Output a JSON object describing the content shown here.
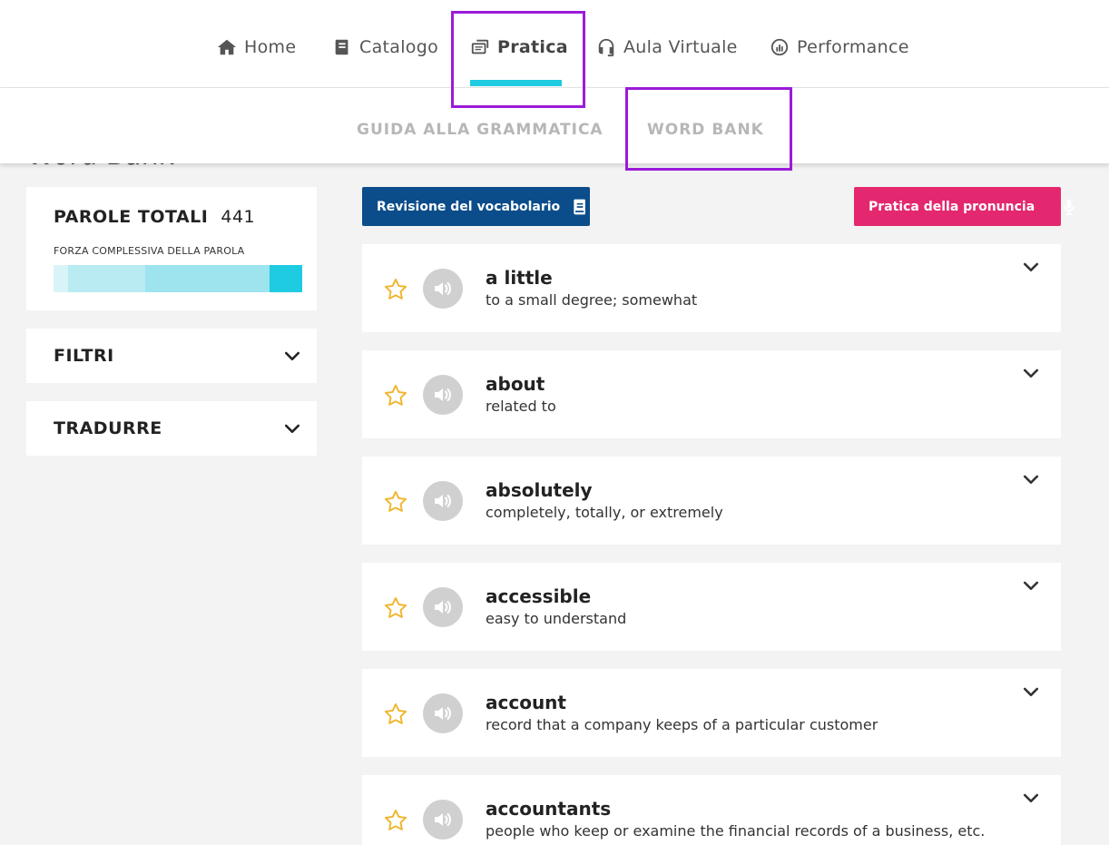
{
  "nav": {
    "items": [
      {
        "label": "Home",
        "icon": "home-icon"
      },
      {
        "label": "Catalogo",
        "icon": "book-icon"
      },
      {
        "label": "Pratica",
        "icon": "practice-icon",
        "active": true
      },
      {
        "label": "Aula Virtuale",
        "icon": "headset-icon"
      },
      {
        "label": "Performance",
        "icon": "chart-icon"
      }
    ]
  },
  "subnav": {
    "grammar": "GUIDA ALLA GRAMMATICA",
    "wordbank": "WORD BANK"
  },
  "page_title": "Word Bank",
  "stats": {
    "title": "PAROLE TOTALI",
    "count": "441",
    "strength_label": "FORZA COMPLESSIVA DELLA PAROLA",
    "strength_segments": [
      {
        "share": 0.06,
        "color": "#d9f4f8"
      },
      {
        "share": 0.31,
        "color": "#b8ebf2"
      },
      {
        "share": 0.5,
        "color": "#9ee4ee"
      },
      {
        "share": 0.13,
        "color": "#1ecbe0"
      }
    ]
  },
  "filters": {
    "label": "FILTRI"
  },
  "translate": {
    "label": "TRADURRE"
  },
  "buttons": {
    "vocab_review": "Revisione del vocabolario",
    "pronunciation": "Pratica della pronuncia"
  },
  "words": [
    {
      "word": "a little",
      "definition": "to a small degree; somewhat"
    },
    {
      "word": "about",
      "definition": "related to"
    },
    {
      "word": "absolutely",
      "definition": "completely, totally, or extremely"
    },
    {
      "word": "accessible",
      "definition": "easy to understand"
    },
    {
      "word": "account",
      "definition": "record that a company keeps of a particular customer"
    },
    {
      "word": "accountants",
      "definition": "people who keep or examine the financial records of a business, etc."
    }
  ],
  "colors": {
    "accent": "#1ecbe0",
    "primary_button": "#0b4d8a",
    "pronunciation_button": "#e3286f",
    "star": "#f0b429",
    "highlight": "#9b1bd8"
  }
}
